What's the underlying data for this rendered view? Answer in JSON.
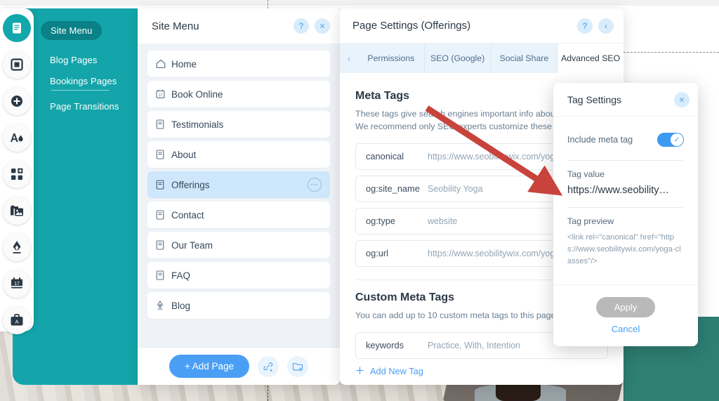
{
  "colors": {
    "teal": "#13a5a9",
    "teal_dark": "#0a8186",
    "accent_blue": "#4a9ff5",
    "arrow_red": "#c8433b",
    "panel_bg": "#eff3f7"
  },
  "rail": {
    "items": [
      {
        "name": "pages-menu-icon",
        "glyph": "pages",
        "active": true
      },
      {
        "name": "sections-icon",
        "glyph": "square"
      },
      {
        "name": "add-elements-icon",
        "glyph": "plus"
      },
      {
        "name": "theme-text-icon",
        "glyph": "a-drop"
      },
      {
        "name": "add-apps-icon",
        "glyph": "apps"
      },
      {
        "name": "media-icon",
        "glyph": "media"
      },
      {
        "name": "blog-icon",
        "glyph": "pen"
      },
      {
        "name": "bookings-icon",
        "glyph": "calendar"
      },
      {
        "name": "business-icon",
        "glyph": "briefcase"
      }
    ]
  },
  "drawer": {
    "active_label": "Site Menu",
    "links": [
      "Blog Pages",
      "Bookings Pages",
      "Page Transitions"
    ]
  },
  "site_menu": {
    "title": "Site Menu",
    "help_label": "?",
    "close_label": "×",
    "pages": [
      {
        "label": "Home",
        "icon": "home-icon",
        "selected": false
      },
      {
        "label": "Book Online",
        "icon": "calendar-icon",
        "selected": false
      },
      {
        "label": "Testimonials",
        "icon": "page-icon",
        "selected": false
      },
      {
        "label": "About",
        "icon": "page-icon",
        "selected": false
      },
      {
        "label": "Offerings",
        "icon": "page-icon",
        "selected": true
      },
      {
        "label": "Contact",
        "icon": "page-icon",
        "selected": false
      },
      {
        "label": "Our Team",
        "icon": "page-icon",
        "selected": false
      },
      {
        "label": "FAQ",
        "icon": "page-icon",
        "selected": false
      },
      {
        "label": "Blog",
        "icon": "pen-icon",
        "selected": false
      }
    ],
    "footer": {
      "add_page_label": "+ Add Page",
      "link_button": "add-link-icon",
      "folder_button": "add-folder-icon"
    }
  },
  "page_settings": {
    "title": "Page Settings (Offerings)",
    "help_label": "?",
    "back_label": "‹",
    "tab_prev_label": "‹",
    "tabs": [
      {
        "label": "Permissions",
        "active": false
      },
      {
        "label": "SEO (Google)",
        "active": false
      },
      {
        "label": "Social Share",
        "active": false
      },
      {
        "label": "Advanced SEO",
        "active": true
      }
    ],
    "meta_tags": {
      "heading": "Meta Tags",
      "description_line1": "These tags give search engines important info about your page.",
      "description_line2": "We recommend only SEO experts customize these tags.",
      "rows": [
        {
          "key": "canonical",
          "value": "https://www.seobilitywix.com/yoga-classes"
        },
        {
          "key": "og:site_name",
          "value": "Seobility Yoga"
        },
        {
          "key": "og:type",
          "value": "website"
        },
        {
          "key": "og:url",
          "value": "https://www.seobilitywix.com/yoga-classes"
        }
      ]
    },
    "custom_meta_tags": {
      "heading": "Custom Meta Tags",
      "description": "You can add up to 10 custom meta tags to this page.",
      "rows": [
        {
          "key": "keywords",
          "value": "Practice, With, Intention"
        }
      ],
      "add_label": "Add New Tag",
      "add_icon": "plus-icon"
    }
  },
  "tag_settings": {
    "title": "Tag Settings",
    "close_label": "×",
    "include_label": "Include meta tag",
    "include_enabled": true,
    "toggle_check": "✓",
    "value_label": "Tag value",
    "value_text": "https://www.seobility…",
    "preview_label": "Tag preview",
    "preview_text": "<link rel=\"canonical\" href=\"https://www.seobilitywix.com/yoga-classes\"/>",
    "apply_label": "Apply",
    "cancel_label": "Cancel"
  },
  "annotation": {
    "arrow": "red-arrow-pointing-to-tag-value"
  }
}
